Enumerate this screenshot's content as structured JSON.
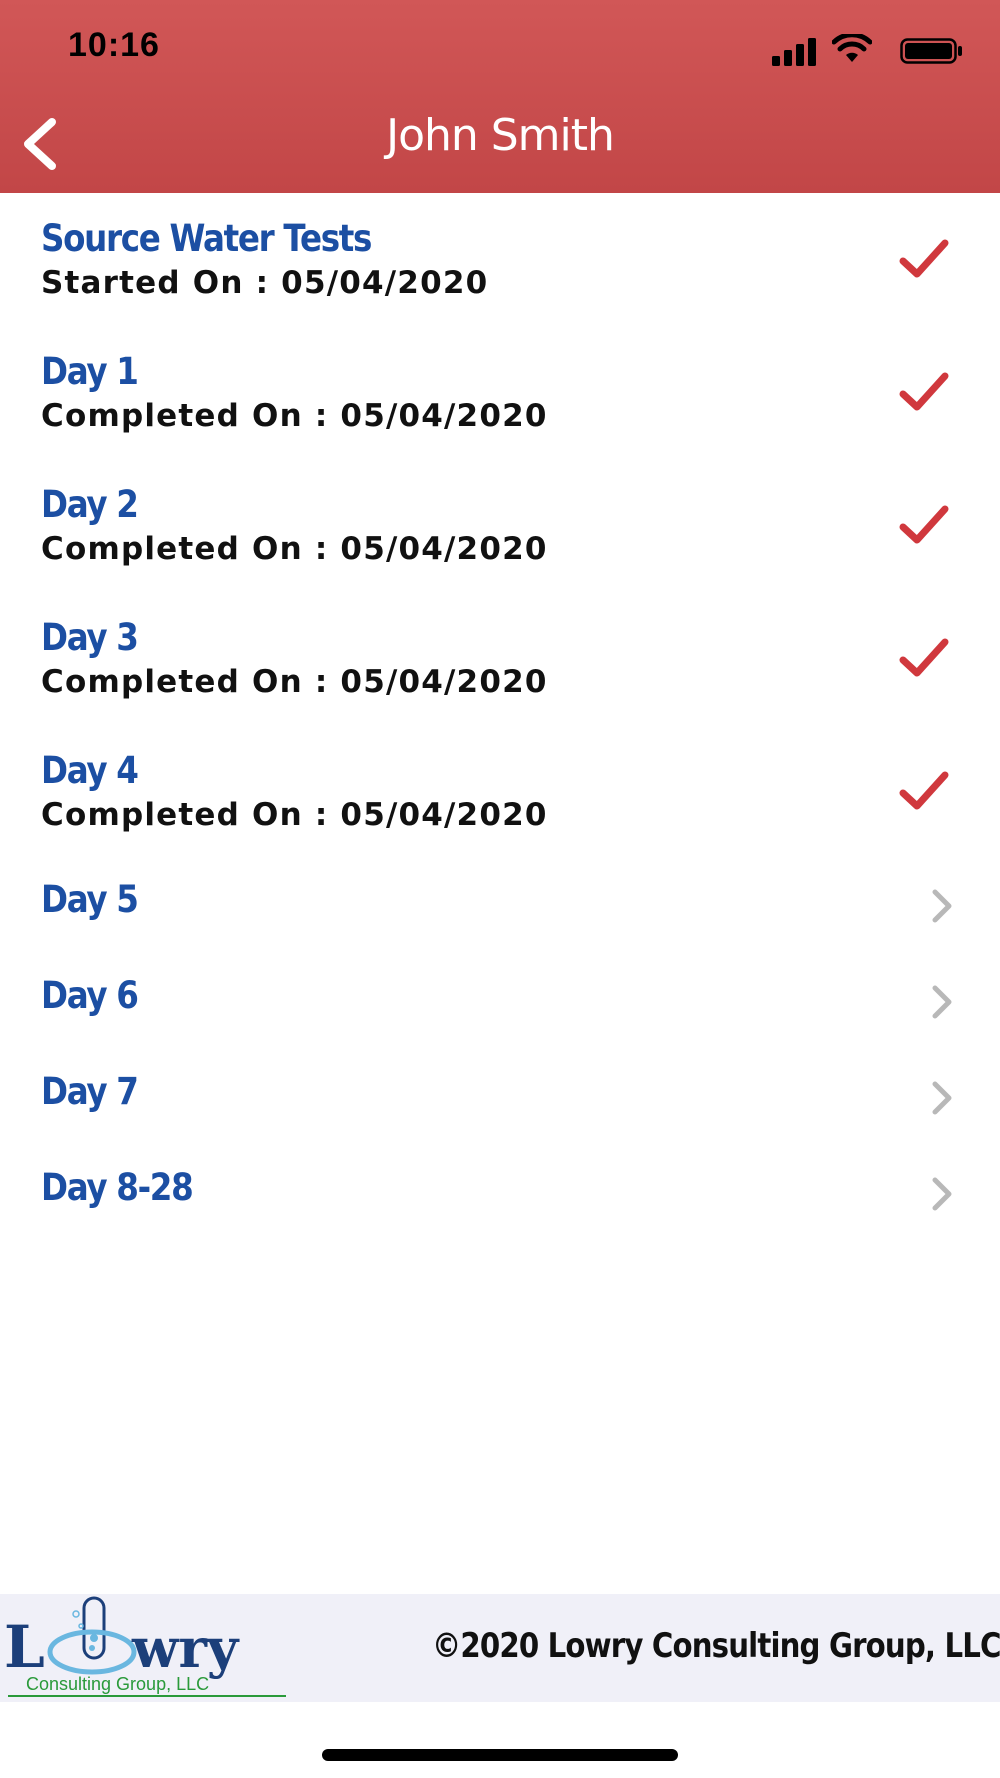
{
  "status_bar": {
    "time": "10:16"
  },
  "header": {
    "title": "John Smith"
  },
  "list": {
    "items": [
      {
        "title": "Source Water Tests",
        "subtitle": "Started On : 05/04/2020",
        "state": "complete"
      },
      {
        "title": "Day 1",
        "subtitle": "Completed On : 05/04/2020",
        "state": "complete"
      },
      {
        "title": "Day 2",
        "subtitle": "Completed On : 05/04/2020",
        "state": "complete"
      },
      {
        "title": "Day 3",
        "subtitle": "Completed On : 05/04/2020",
        "state": "complete"
      },
      {
        "title": "Day 4",
        "subtitle": "Completed On : 05/04/2020",
        "state": "complete"
      },
      {
        "title": "Day 5",
        "state": "pending"
      },
      {
        "title": "Day 6",
        "state": "pending"
      },
      {
        "title": "Day 7",
        "state": "pending"
      },
      {
        "title": "Day 8-28",
        "state": "pending"
      }
    ]
  },
  "footer": {
    "copyright": "©2020 Lowry Consulting Group, LLC",
    "logo_text": "Lowry",
    "logo_subtext": "Consulting Group, LLC"
  },
  "colors": {
    "header": "#c94b4c",
    "title_blue": "#1c4fa3",
    "check_red": "#d0383d",
    "chevron_gray": "#b8b8b8",
    "logo_green": "#2a9a3a"
  }
}
